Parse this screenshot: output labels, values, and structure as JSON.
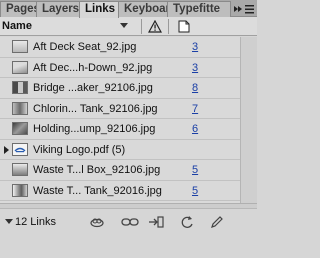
{
  "tabs": [
    {
      "label": "Pages",
      "active": false
    },
    {
      "label": "Layers",
      "active": false
    },
    {
      "label": "Links",
      "active": true
    },
    {
      "label": "Keyboar",
      "active": false
    },
    {
      "label": "Typefitte",
      "active": false
    }
  ],
  "header": {
    "name_label": "Name"
  },
  "links": [
    {
      "name": "Aft Deck Seat_92.jpg",
      "page": "3",
      "thumb": "boat-deck"
    },
    {
      "name": "Aft Dec...h-Down_92.jpg",
      "page": "3",
      "thumb": "boat-deck"
    },
    {
      "name": "Bridge ...aker_92106.jpg",
      "page": "8",
      "thumb": "bridge"
    },
    {
      "name": "Chlorin... Tank_92106.jpg",
      "page": "7",
      "thumb": "tank"
    },
    {
      "name": "Holding...ump_92106.jpg",
      "page": "6",
      "thumb": "pump"
    },
    {
      "name": "Viking Logo.pdf (5)",
      "page": "",
      "thumb": "logo",
      "group": true
    },
    {
      "name": "Waste T...l Box_92106.jpg",
      "page": "5",
      "thumb": "box"
    },
    {
      "name": "Waste T... Tank_92016.jpg",
      "page": "5",
      "thumb": "tank"
    }
  ],
  "footer": {
    "count": "12 Links"
  },
  "colors": {
    "page_link": "#1a3fa6",
    "panel_bg": "#d6d6d6",
    "tab_bar": "#a9a9a9"
  }
}
